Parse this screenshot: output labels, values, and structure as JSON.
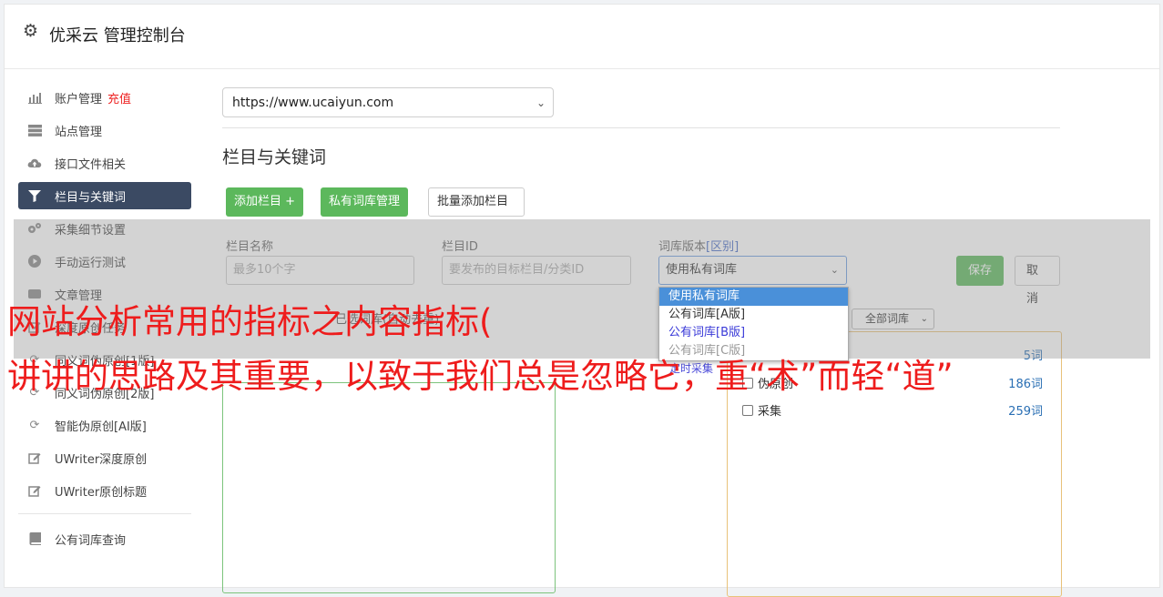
{
  "app": {
    "title": "优采云 管理控制台"
  },
  "sidebar": {
    "items": [
      {
        "label": "账户管理",
        "extra": "充值",
        "icon": "bar-chart-icon"
      },
      {
        "label": "站点管理",
        "icon": "server-icon"
      },
      {
        "label": "接口文件相关",
        "icon": "cloud-upload-icon"
      },
      {
        "label": "栏目与关键词",
        "icon": "filter-icon",
        "active": true
      },
      {
        "label": "采集细节设置",
        "icon": "cogs-icon"
      },
      {
        "label": "手动运行测试",
        "icon": "play-circle-icon"
      },
      {
        "label": "文章管理",
        "icon": "file-icon"
      },
      {
        "label": "深度原创任务",
        "icon": "edit-icon"
      },
      {
        "label": "同义词伪原创[1版]",
        "icon": "refresh-icon"
      },
      {
        "label": "同义词伪原创[2版]",
        "icon": "refresh-icon"
      },
      {
        "label": "智能伪原创[AI版]",
        "icon": "refresh-icon"
      },
      {
        "label": "UWriter深度原创",
        "icon": "edit-icon"
      },
      {
        "label": "UWriter原创标题",
        "icon": "edit-icon"
      }
    ],
    "bottom_items": [
      {
        "label": "公有词库查询",
        "icon": "book-icon"
      }
    ]
  },
  "main": {
    "site_select": "https://www.ucaiyun.com",
    "section_title": "栏目与关键词",
    "buttons": {
      "add_column": "添加栏目 +",
      "private_lib": "私有词库管理",
      "batch_add": "批量添加栏目"
    },
    "form": {
      "name_label": "栏目名称",
      "name_placeholder": "最多10个字",
      "id_label": "栏目ID",
      "id_placeholder": "要发布的目标栏目/分类ID",
      "version_label": "词库版本",
      "version_link": "[区别]",
      "version_value": "使用私有词库",
      "save": "保存",
      "cancel": "取消"
    },
    "version_options": [
      "使用私有词库",
      "公有词库[A版]",
      "公有词库[B版]",
      "公有词库[C版]"
    ],
    "left_box_title": "已选词库(自动去重)",
    "lib_filter": "全部词库",
    "libs": [
      {
        "name": "伪原创",
        "count": "186词"
      },
      {
        "name": "采集",
        "count": "259词"
      }
    ],
    "partial_count": "5词",
    "link_text": "定时采集"
  },
  "watermark": {
    "line1": "网站分析常用的指标之内容指标(",
    "line2": "讲讲的思路及其重要，以致于我们总是忽略它，重“术”而轻“道”"
  }
}
